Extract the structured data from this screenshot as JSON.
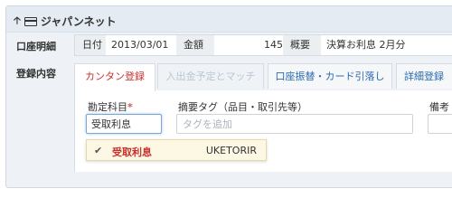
{
  "header": {
    "account_name": "ジャパンネット",
    "collapse_icon": "arrow-up-icon",
    "account_icon": "credit-card-icon"
  },
  "labels": {
    "detail": "口座明細",
    "register": "登録内容"
  },
  "detail": {
    "date_label": "日付",
    "date_value": "2013/03/01",
    "amount_label": "金額",
    "amount_value": "145",
    "summary_label": "概要",
    "summary_value": "決算お利息 2月分"
  },
  "tabs": [
    {
      "label": "カンタン登録",
      "state": "active"
    },
    {
      "label": "入出金予定とマッチ",
      "state": "disabled"
    },
    {
      "label": "口座振替・カード引落し",
      "state": "normal"
    },
    {
      "label": "詳細登録",
      "state": "normal"
    }
  ],
  "form": {
    "kamoku_label": "勘定科目",
    "required_mark": "*",
    "kamoku_value": "受取利息",
    "tag_label": "摘要タグ（品目・取引先等）",
    "tag_placeholder": "タグを追加",
    "memo_label": "備考"
  },
  "suggestion": {
    "name": "受取利息",
    "code": "UKETORIR",
    "check_icon": "check-icon"
  },
  "colors": {
    "accent_red": "#c9302c",
    "link_blue": "#2a6bb0",
    "suggest_bg": "#fcf8e3"
  }
}
